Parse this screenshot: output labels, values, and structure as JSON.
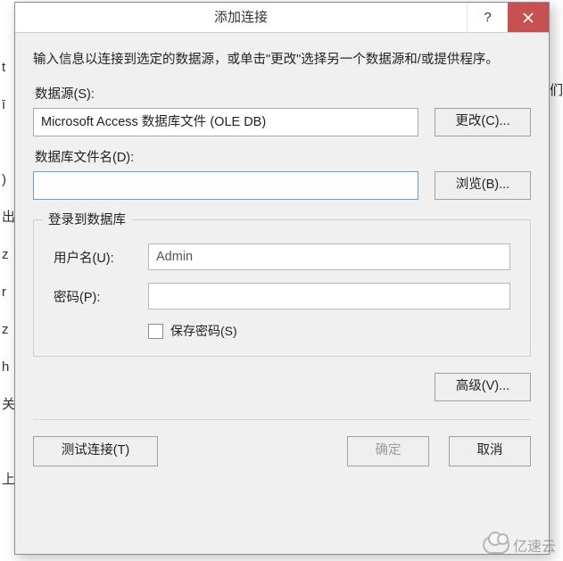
{
  "window": {
    "title": "添加连接",
    "help": "?",
    "close": "×"
  },
  "intro": "输入信息以连接到选定的数据源，或单击\"更改\"选择另一个数据源和/或提供程序。",
  "datasource": {
    "label": "数据源(S):",
    "value": "Microsoft Access 数据库文件 (OLE DB)",
    "change_btn": "更改(C)..."
  },
  "dbfile": {
    "label": "数据库文件名(D):",
    "value": "",
    "browse_btn": "浏览(B)..."
  },
  "login_group": {
    "legend": "登录到数据库",
    "username_label": "用户名(U):",
    "username_value": "Admin",
    "password_label": "密码(P):",
    "password_value": "",
    "save_password_label": "保存密码(S)",
    "save_password_checked": false
  },
  "advanced_btn": "高级(V)...",
  "footer": {
    "test_btn": "测试连接(T)",
    "ok_btn": "确定",
    "cancel_btn": "取消"
  },
  "watermark": "亿速云",
  "bg_right": "们"
}
